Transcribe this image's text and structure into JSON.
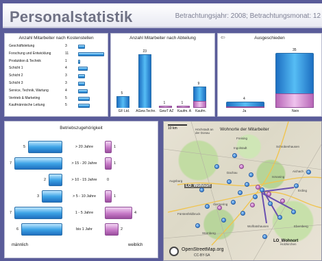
{
  "header": {
    "title": "Personalstatistik",
    "period": "Betrachtungsjahr: 2008; Betrachtungsmonat: 12"
  },
  "panels": {
    "cost_centers": {
      "title": "Anzahl Mitarbeiter nach Kostenstellen",
      "chart_data": {
        "type": "bar",
        "orientation": "horizontal",
        "categories": [
          "Geschäftsleitung",
          "Forschung und Entwicklung",
          "Produktion & Technik",
          "Schicht 1",
          "Schicht 2",
          "Schicht 3",
          "Service, Technik, Wartung",
          "Vertrieb & Marketing",
          "Kaufmännische Leitung"
        ],
        "values": [
          3,
          11,
          1,
          4,
          3,
          3,
          4,
          5,
          5
        ],
        "xlim": [
          0,
          11
        ]
      }
    },
    "departments": {
      "title": "Anzahl Mitarbeiter nach Abteilung",
      "chart_data": {
        "type": "bar",
        "categories": [
          "GF Ltd.",
          "AGew.Techn.",
          "GewT AZ",
          "Kaufm. A",
          "Kaufm."
        ],
        "series": [
          {
            "values": [
              5,
              23,
              1,
              1,
              9
            ]
          }
        ],
        "stack_pink": [
          0,
          0,
          1,
          1,
          3
        ],
        "ylim": [
          0,
          23
        ]
      }
    },
    "left": {
      "title": "Ausgeschieden",
      "arrow_icon": "⇦",
      "chart_data": {
        "type": "bar",
        "categories": [
          "Ja",
          "Nein"
        ],
        "values": [
          4,
          35
        ],
        "pink_part": [
          1,
          9
        ],
        "ylim": [
          0,
          35
        ]
      }
    },
    "tenure": {
      "title": "Betriebszugehörigkeit",
      "left_label": "männlich",
      "right_label": "weiblich",
      "chart_data": {
        "type": "bar",
        "orientation": "horizontal",
        "categories": [
          "> 20 Jahre",
          "> 15 - 20 Jahre",
          "> 10 - 15 Jahre",
          "> 5 - 10 Jahre",
          "1 - 5 Jahre",
          "bis 1 Jahr"
        ],
        "series": [
          {
            "name": "männlich",
            "values": [
              5,
              7,
              2,
              3,
              7,
              6
            ]
          },
          {
            "name": "weiblich",
            "values": [
              1,
              1,
              0,
              1,
              4,
              2
            ]
          }
        ],
        "xlim": [
          0,
          7
        ]
      }
    },
    "map": {
      "title": "Wohnorte der Mitarbeiter",
      "scale_label": "10 km",
      "hint_label": "Höchstadt an der Donau",
      "bottom_label": "LO_Wohnort",
      "top_label": "LO_Wohnort",
      "attribution": "OpenStreetMap.org",
      "attribution_sub": "CC-BY-SA",
      "towns": [
        "Ingolstadt",
        "Schrobenhausen",
        "Aichach",
        "Dachau",
        "Ismaning",
        "Freising",
        "Erding",
        "Augsburg",
        "Germering",
        "Fürstenfeldbruck",
        "Starnberg",
        "Ebersberg",
        "Wolfratshausen",
        "Holzkirchen"
      ]
    }
  }
}
